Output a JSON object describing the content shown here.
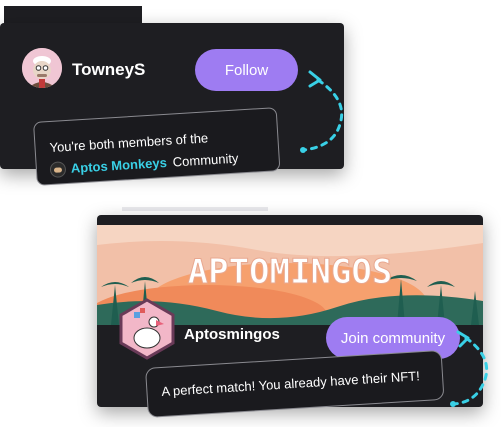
{
  "follow_card": {
    "username": "TowneyS",
    "follow_label": "Follow",
    "tooltip_line1": "You're both members of the",
    "community_link": "Aptos Monkeys",
    "community_suffix": "Community"
  },
  "community_card": {
    "banner_title": "APTOMINGOS",
    "name": "Aptosmingos",
    "join_label": "Join community",
    "tooltip": "A perfect match! You already have their NFT!"
  },
  "colors": {
    "card_bg": "#1e1e22",
    "accent_purple": "#9e7cf2",
    "accent_cyan": "#39d0e6"
  }
}
